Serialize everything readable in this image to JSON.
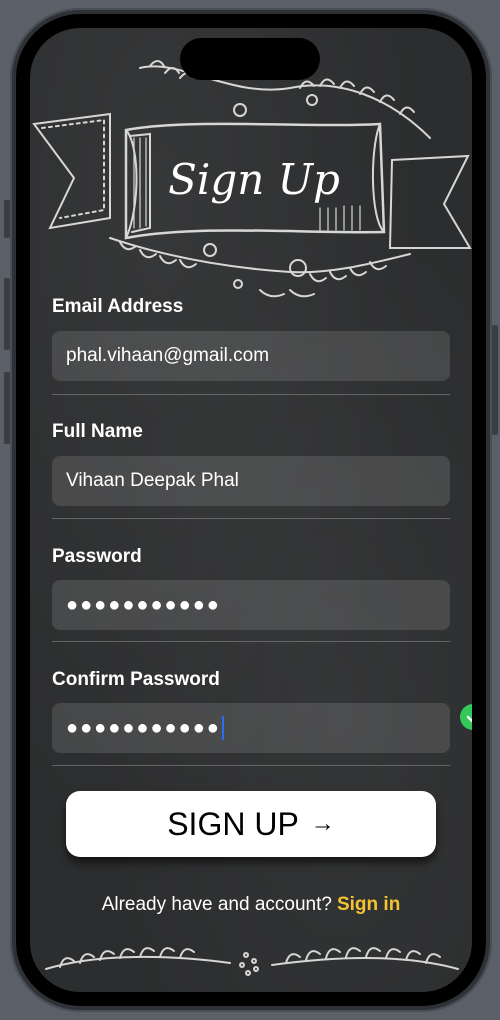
{
  "header": {
    "title": "Sign Up"
  },
  "form": {
    "email": {
      "label": "Email Address",
      "value": "phal.vihaan@gmail.com"
    },
    "full_name": {
      "label": "Full Name",
      "value": "Vihaan Deepak Phal"
    },
    "password": {
      "label": "Password",
      "value": "●●●●●●●●●●●"
    },
    "confirm_password": {
      "label": "Confirm Password",
      "value": "●●●●●●●●●●●"
    }
  },
  "signup_button": {
    "label": "SIGN UP",
    "arrow": "→"
  },
  "footer": {
    "prompt": "Already have and account?",
    "link": "Sign in"
  },
  "colors": {
    "link": "#f4c430",
    "check": "#34c759",
    "caret": "#2d6cf6"
  },
  "icons": [
    "arrow-right-icon",
    "checkmark-icon"
  ]
}
